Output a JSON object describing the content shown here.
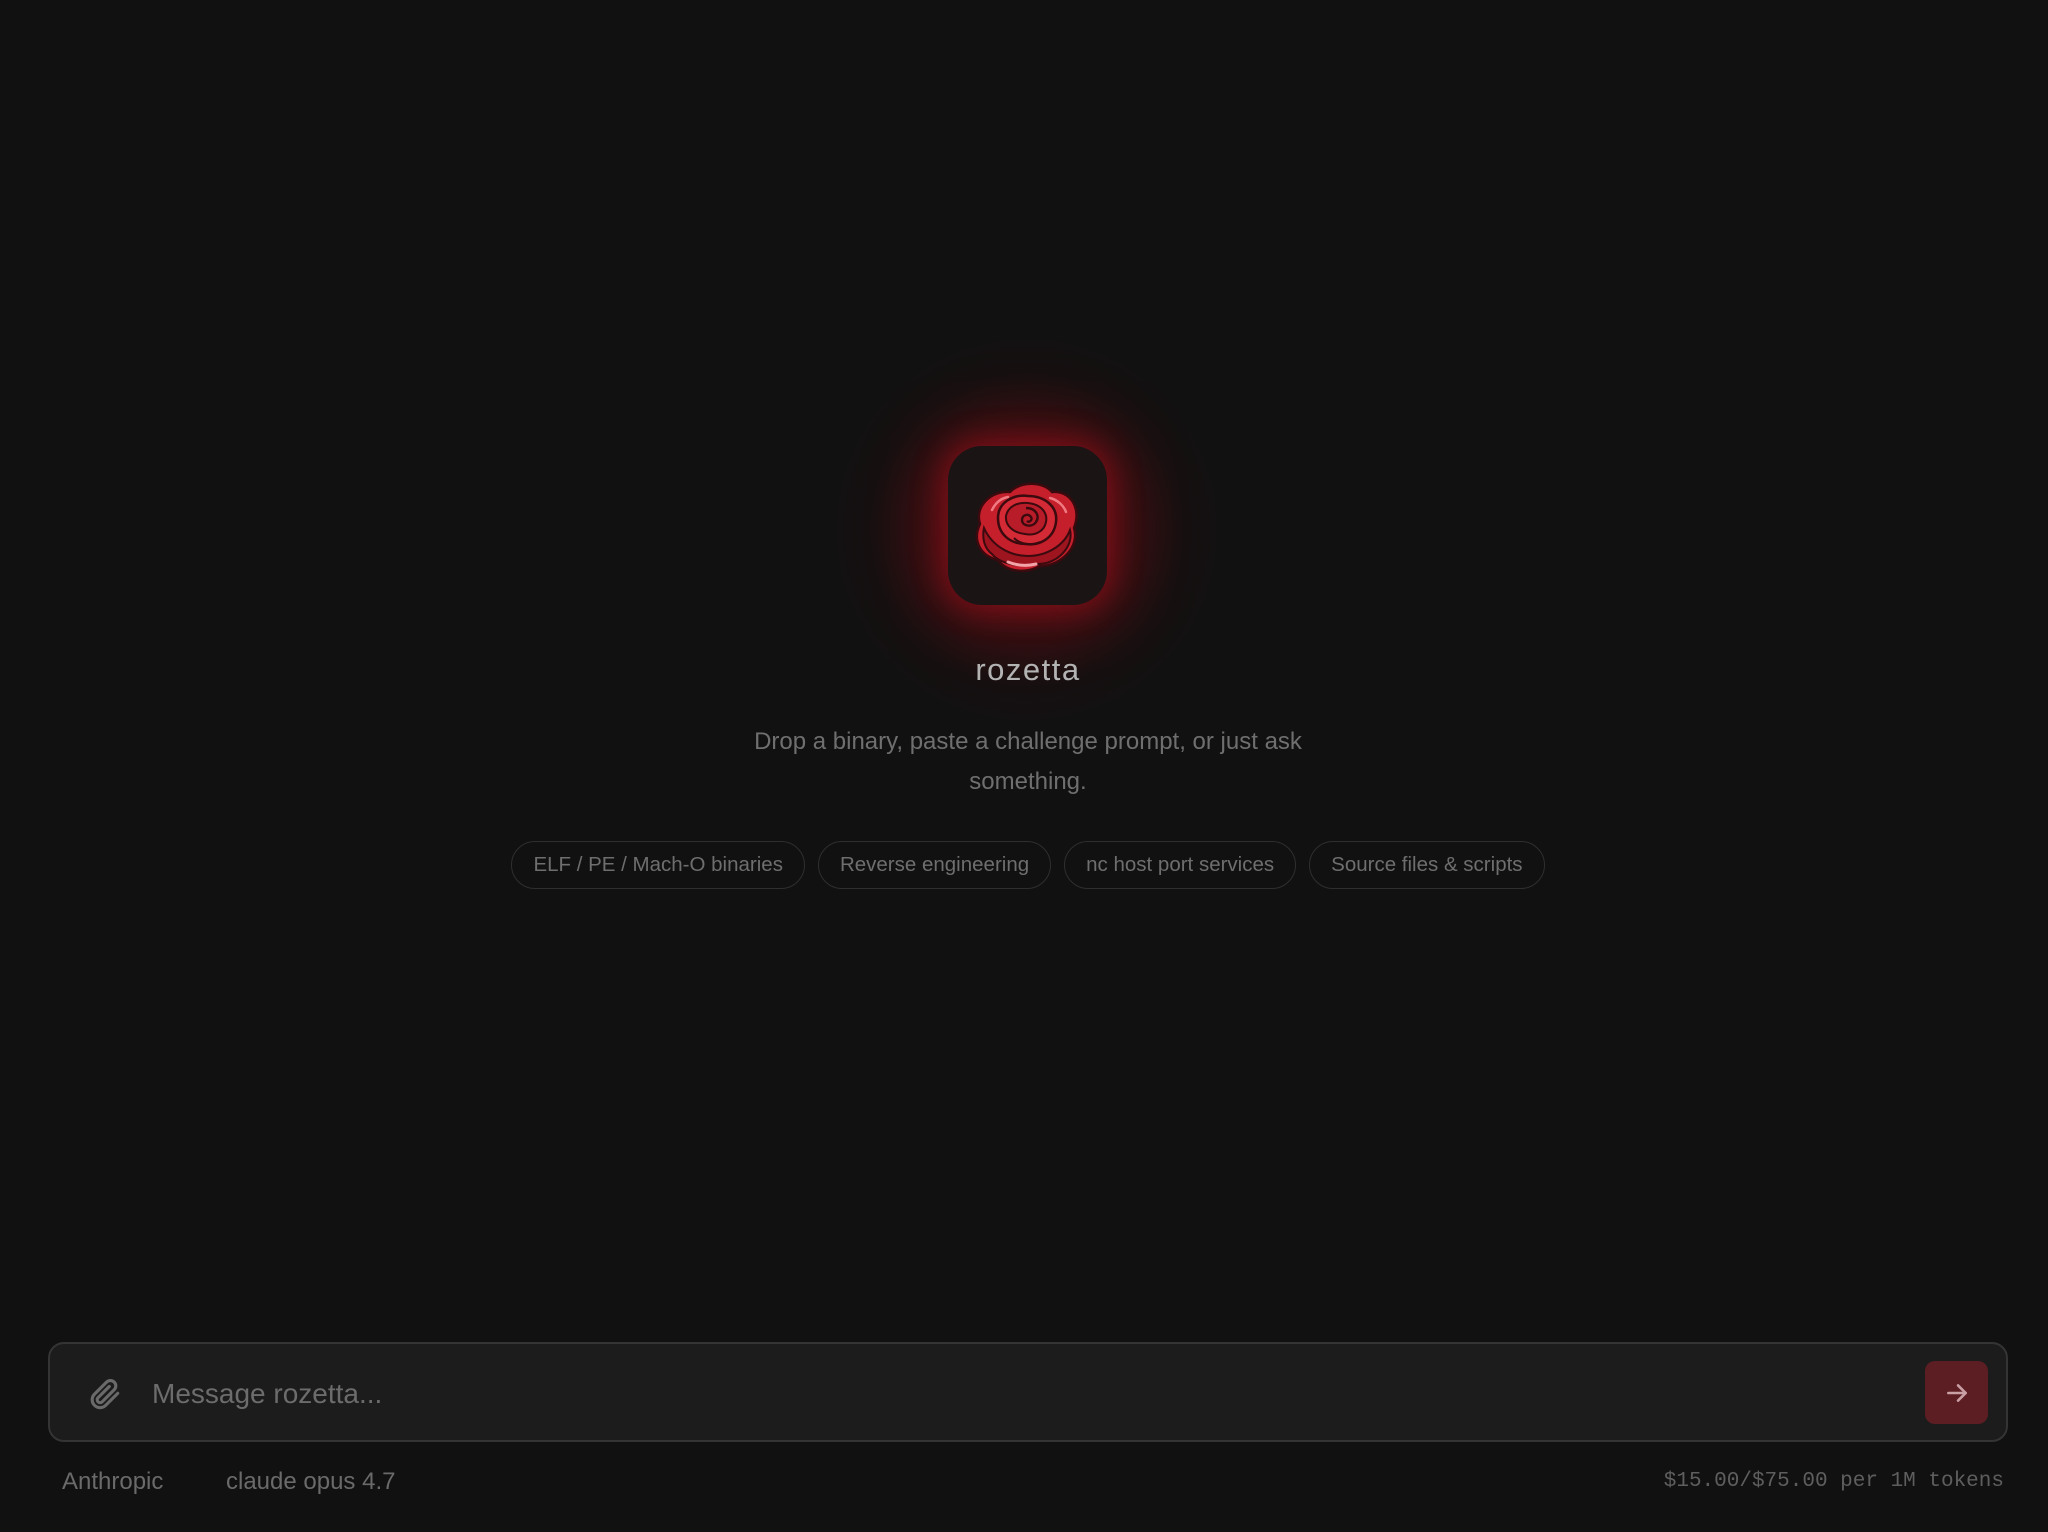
{
  "app": {
    "name": "rozetta",
    "tagline": "Drop a binary, paste a challenge prompt, or just ask something.",
    "logo_icon": "rose-icon",
    "accent_color": "#c8202c"
  },
  "suggestions": [
    {
      "label": "ELF / PE / Mach-O binaries"
    },
    {
      "label": "Reverse engineering"
    },
    {
      "label": "nc host port services"
    },
    {
      "label": "Source files & scripts"
    }
  ],
  "composer": {
    "placeholder": "Message rozetta...",
    "value": "",
    "attach_icon": "paperclip-icon",
    "send_icon": "arrow-right-icon",
    "send_color": "#5c1d23"
  },
  "footer": {
    "provider": "Anthropic",
    "model": "claude opus 4.7",
    "pricing": "$15.00/$75.00 per 1M tokens"
  }
}
